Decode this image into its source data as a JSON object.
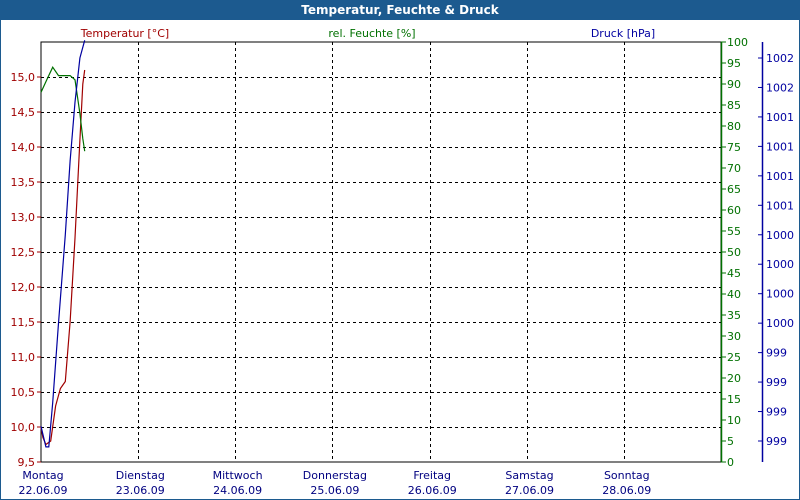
{
  "window": {
    "title": "Temperatur, Feuchte & Druck"
  },
  "colors": {
    "temp": "#a00000",
    "hum": "#007000",
    "press": "#0000a0",
    "grid": "#000000",
    "titlebar": "#1c5a8f"
  },
  "chart_data": {
    "type": "line",
    "title": "Temperatur, Feuchte & Druck",
    "grid": true,
    "x_ticks": [
      {
        "day": "Montag",
        "date": "22.06.09"
      },
      {
        "day": "Dienstag",
        "date": "23.06.09"
      },
      {
        "day": "Mittwoch",
        "date": "24.06.09"
      },
      {
        "day": "Donnerstag",
        "date": "25.06.09"
      },
      {
        "day": "Freitag",
        "date": "26.06.09"
      },
      {
        "day": "Samstag",
        "date": "27.06.09"
      },
      {
        "day": "Sonntag",
        "date": "28.06.09"
      }
    ],
    "xlim_days": [
      0,
      7
    ],
    "axes": {
      "temp": {
        "label": "Temperatur [°C]",
        "ylim": [
          9.5,
          15.5
        ],
        "ticks": [
          "9,5",
          "10,0",
          "10,5",
          "11,0",
          "11,5",
          "12,0",
          "12,5",
          "13,0",
          "13,5",
          "14,0",
          "14,5",
          "15,0"
        ]
      },
      "hum": {
        "label": "rel. Feuchte [%]",
        "ylim": [
          0,
          100
        ],
        "ticks": [
          "0",
          "5",
          "10",
          "15",
          "20",
          "25",
          "30",
          "35",
          "40",
          "45",
          "50",
          "55",
          "60",
          "65",
          "70",
          "75",
          "80",
          "85",
          "90",
          "95",
          "100"
        ]
      },
      "press": {
        "label": "Druck [hPa]",
        "ticks": [
          "999",
          "999",
          "999",
          "999",
          "1000",
          "1000",
          "1000",
          "1000",
          "1001",
          "1001",
          "1001",
          "1001",
          "1002",
          "1002"
        ]
      }
    },
    "series": [
      {
        "name": "Temperatur [°C]",
        "axis": "temp",
        "points": [
          [
            0,
            10.0
          ],
          [
            0.02,
            9.85
          ],
          [
            0.05,
            9.75
          ],
          [
            0.1,
            9.8
          ],
          [
            0.15,
            10.3
          ],
          [
            0.2,
            10.55
          ],
          [
            0.25,
            10.65
          ],
          [
            0.3,
            11.5
          ],
          [
            0.35,
            12.7
          ],
          [
            0.4,
            14.1
          ],
          [
            0.43,
            14.9
          ],
          [
            0.45,
            15.1
          ]
        ]
      },
      {
        "name": "rel. Feuchte [%]",
        "axis": "hum",
        "points": [
          [
            0,
            88
          ],
          [
            0.06,
            91
          ],
          [
            0.12,
            94
          ],
          [
            0.18,
            92
          ],
          [
            0.24,
            92
          ],
          [
            0.3,
            92
          ],
          [
            0.35,
            91
          ],
          [
            0.4,
            83
          ],
          [
            0.43,
            77
          ],
          [
            0.45,
            74
          ]
        ]
      },
      {
        "name": "Druck [hPa]",
        "axis": "press",
        "ylim_index": [
          0,
          14
        ],
        "points": [
          [
            0,
            0.5
          ],
          [
            0.05,
            -0.2
          ],
          [
            0.08,
            -0.2
          ],
          [
            0.12,
            1.3
          ],
          [
            0.18,
            4.0
          ],
          [
            0.25,
            7.0
          ],
          [
            0.3,
            9.5
          ],
          [
            0.35,
            11.5
          ],
          [
            0.4,
            13.0
          ],
          [
            0.45,
            13.6
          ]
        ]
      }
    ]
  }
}
